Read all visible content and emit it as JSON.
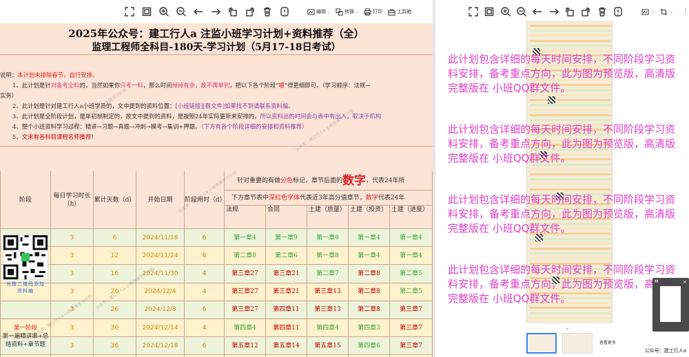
{
  "left_toolbar": {
    "edit_label": "编辑",
    "convert_label": "转换",
    "print_label": "打印",
    "toolbox_label": "工具箱"
  },
  "doc": {
    "title_line1": "2025年公众号：建工行人a 注监小班学习计划+资料推荐（全）",
    "title_line2": "监理工程师全科目-180天-学习计划（5月17-18日考试）",
    "notes": {
      "line0_prefix": "说明：",
      "line0_red": "本计划未排除春节，自行安排。",
      "line1_a": "1、此计划是针",
      "line1_b": "对备考全科",
      "line1_c": "的，当然如果你",
      "line1_d": "只考一科",
      "line1_e": "，那么时间",
      "line1_f": "绰绰有余，故不再单列",
      "line1_g": "，把以下各个阶段“",
      "line1_h": "嚼",
      "line1_i": "”得更细即可。（学习顺序：法规→",
      "line1b": "实务）",
      "line2_a": "2、此计划是针对建工行人a小班学员的，文中提到的资料位置：",
      "line2_b": "[小班链接][群文件]如果找不到请联系资料编。",
      "line3_a": "3、此计划是全阶段计划，是年初就制定的，故文中提到的资料，是按照24年实际更新来安排的，",
      "line3_b": "所以资料出的时间会与表中有出入，取决于机构",
      "line4_a": "4、整个小班资料学习过程：精讲→习题→真题→冲刺→模考→集训+押题。",
      "line4_b": "（下方有各个阶段详细的安排和资料推荐）",
      "line5_a": "5、",
      "line5_b": "文末有各科目课程名师推荐",
      "line5_c": "！"
    },
    "table": {
      "headers": {
        "stage": "阶段",
        "daily_hours": "每日学习时长（h）",
        "cumulative_days": "累计天数（d）",
        "start_date": "开始日期",
        "stage_days": "阶段用时（d）",
        "top_note_a": "针对重要的有做",
        "top_note_b": "分色",
        "top_note_c": "标记，章节后面的",
        "top_note_big": "数字",
        "top_note_d": "，代表24年所",
        "sub_note_a": "下方章节表中",
        "sub_note_b": "深红色字体",
        "sub_note_c": "代表近3年高分值章节，",
        "sub_note_d": "数字",
        "sub_note_e": "代表24年",
        "subjects": [
          "法规",
          "合同",
          "土建（质量）",
          "土建（投资）",
          "土建（进度）"
        ]
      },
      "rows": [
        {
          "hours": "3",
          "days": "6",
          "date": "2024/11/18",
          "stage_days": "6",
          "c": [
            "第一章4",
            "第一章9",
            "第一章8",
            "第一章4",
            "第一章4"
          ],
          "cc": [
            "g",
            "g",
            "g",
            "g",
            "g"
          ]
        },
        {
          "hours": "3",
          "days": "12",
          "date": "2024/11/24",
          "stage_days": "6",
          "c": [
            "第二章8",
            "第二章6",
            "第一章8",
            "第一章4",
            "第一章4"
          ],
          "cc": [
            "g",
            "g",
            "g",
            "g",
            "g"
          ]
        },
        {
          "hours": "3",
          "days": "16",
          "date": "2024/11/30",
          "stage_days": "4",
          "c": [
            "第三章27",
            "第三章21",
            "第二章7",
            "第二章8",
            "第二章5"
          ],
          "cc": [
            "r",
            "r",
            "g",
            "r",
            "g"
          ]
        },
        {
          "hours": "3",
          "days": "20",
          "date": "2024/12/4",
          "stage_days": "4",
          "c": [
            "第三章27",
            "第三章21",
            "第三章13",
            "第二章8",
            "第二章5"
          ],
          "cc": [
            "r",
            "r",
            "r",
            "r",
            "g"
          ]
        },
        {
          "hours": "3",
          "days": "26",
          "date": "2024/12/8",
          "stage_days": "6",
          "c": [
            "第三章27",
            "第四章11",
            "第三章13",
            "第二章8",
            "第三章7"
          ],
          "cc": [
            "r",
            "r",
            "r",
            "r",
            "r"
          ]
        },
        {
          "hours": "3",
          "days": "30",
          "date": "2024/12/14",
          "stage_days": "4",
          "c": [
            "第四章4",
            "第四章11",
            "第四章4",
            "第四章3",
            "第三章7"
          ],
          "cc": [
            "g",
            "r",
            "g",
            "g",
            "r"
          ]
        },
        {
          "hours": "3",
          "days": "36",
          "date": "2024/12/18",
          "stage_days": "6",
          "c": [
            "第五章12",
            "第五章14",
            "第五章15",
            "第四章6",
            "第三章7"
          ],
          "cc": [
            "r",
            "r",
            "r",
            "g",
            "r"
          ]
        },
        {
          "hours": "3",
          "days": "40",
          "date": "2024/12/24",
          "stage_days": "4",
          "c": [
            "第六章9",
            "第六章20",
            "第五章15",
            "第五章4",
            "第四章3"
          ],
          "cc": [
            "b",
            "r",
            "r",
            "g",
            "g"
          ]
        }
      ],
      "stage_label": "第一阶段",
      "stage_desc": "第一遍精讲串+总结资料+章节题"
    },
    "qr_caption": "长按二维码添加资料编",
    "watermark": "公众号：建工行人a 小班专属学习计划"
  },
  "right": {
    "overlay_paragraph": "此计划包含详细的每天时间安排，不同阶段学习资料安排，备考重点方向，此为图为预览版，高清版完整版在 小班QQ群文件。",
    "more_label": "查看更多",
    "brand": "公众号：建工行人a"
  },
  "colors": {
    "doc_bg": "#fce4d6",
    "row_green": "#eef4dc",
    "row_yellow": "#fff2cc",
    "green_text": "#3aa33a",
    "red_text": "#c00000",
    "overlay_magenta": "#e040c8",
    "active_thumb": "#3b82f6"
  },
  "icons": [
    "fullscreen-icon",
    "fit-page-icon",
    "zoom-in-icon",
    "zoom-out-icon",
    "arrow-left-icon",
    "arrow-right-icon",
    "rotate-left-icon",
    "rotate-right-icon",
    "delete-icon",
    "info-icon"
  ]
}
